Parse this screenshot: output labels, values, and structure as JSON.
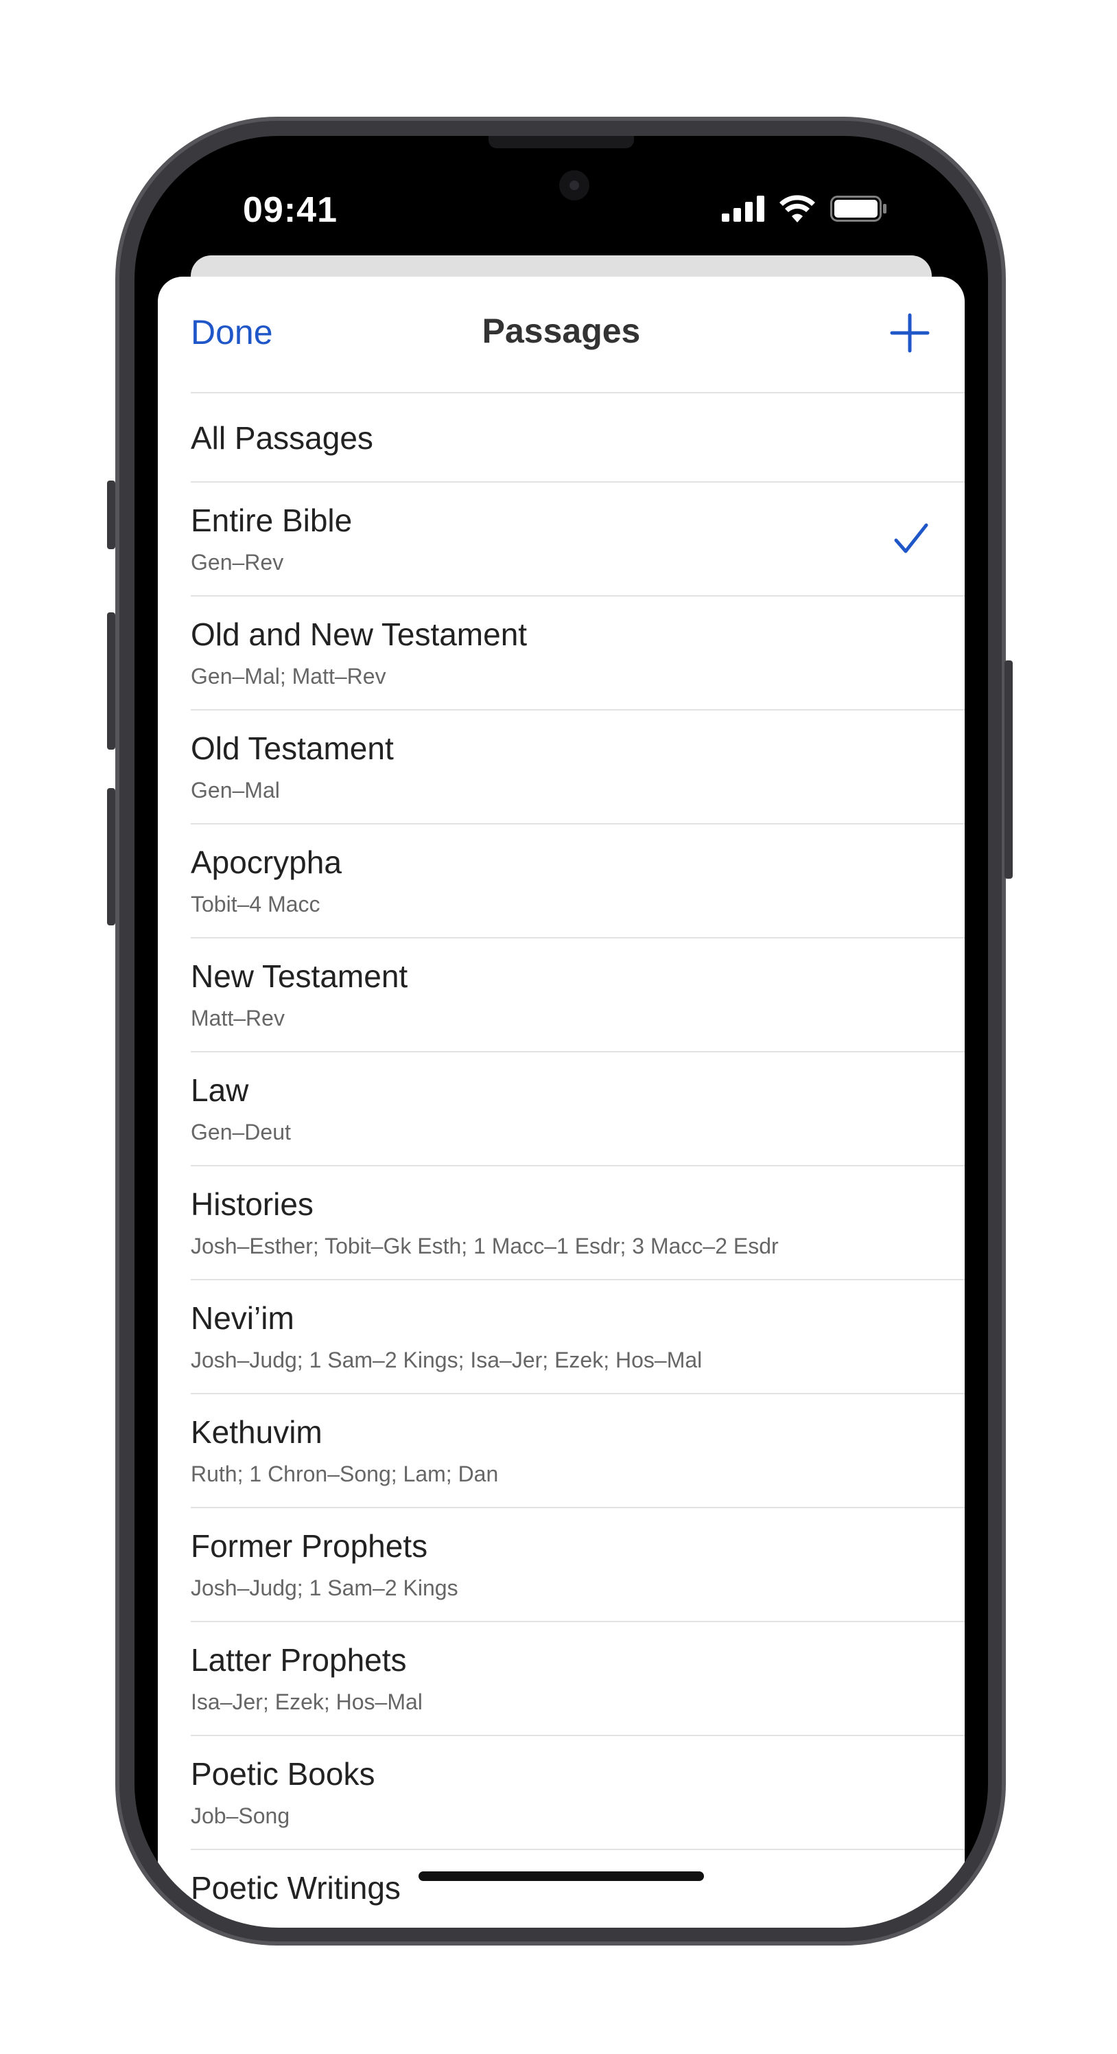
{
  "status_bar": {
    "time": "09:41"
  },
  "nav": {
    "done_label": "Done",
    "title": "Passages"
  },
  "all_passages": {
    "title": "All Passages"
  },
  "passages": [
    {
      "title": "Entire Bible",
      "range": "Gen–Rev",
      "selected": true
    },
    {
      "title": "Old and New Testament",
      "range": "Gen–Mal; Matt–Rev"
    },
    {
      "title": "Old Testament",
      "range": "Gen–Mal"
    },
    {
      "title": "Apocrypha",
      "range": "Tobit–4 Macc"
    },
    {
      "title": "New Testament",
      "range": "Matt–Rev"
    },
    {
      "title": "Law",
      "range": "Gen–Deut"
    },
    {
      "title": "Histories",
      "range": "Josh–Esther; Tobit–Gk Esth; 1 Macc–1 Esdr; 3 Macc–2 Esdr"
    },
    {
      "title": "Nevi’im",
      "range": "Josh–Judg; 1 Sam–2 Kings; Isa–Jer; Ezek; Hos–Mal"
    },
    {
      "title": "Kethuvim",
      "range": "Ruth; 1 Chron–Song; Lam; Dan"
    },
    {
      "title": "Former Prophets",
      "range": "Josh–Judg; 1 Sam–2 Kings"
    },
    {
      "title": "Latter Prophets",
      "range": "Isa–Jer; Ezek; Hos–Mal"
    },
    {
      "title": "Poetic Books",
      "range": "Job–Song"
    },
    {
      "title": "Poetic Writings",
      "range": ""
    }
  ],
  "colors": {
    "accent": "#1f56c8"
  }
}
